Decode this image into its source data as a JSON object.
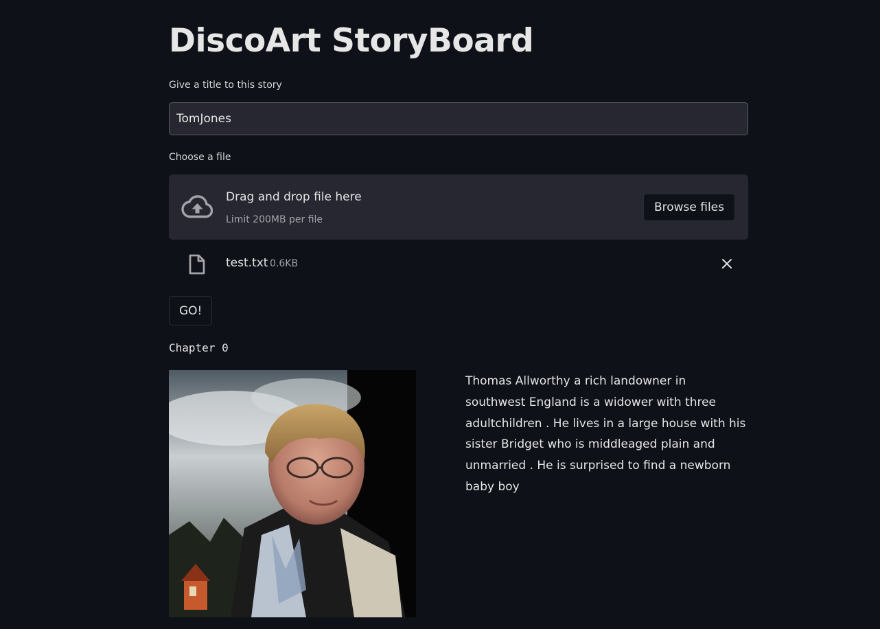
{
  "app": {
    "title": "DiscoArt StoryBoard"
  },
  "story_title": {
    "label": "Give a title to this story",
    "value": "TomJones"
  },
  "uploader": {
    "label": "Choose a file",
    "drop_text": "Drag and drop file here",
    "limit_text": "Limit 200MB per file",
    "browse_label": "Browse files",
    "icon": "cloud-upload-icon"
  },
  "uploaded_file": {
    "name": "test.txt",
    "size": "0.6KB",
    "icon": "file-icon",
    "remove_icon": "close-icon"
  },
  "go_button": {
    "label": "GO!"
  },
  "chapter": {
    "heading": "Chapter 0",
    "text": "Thomas Allworthy a rich landowner in southwest England is a widower with three adultchildren . He lives in a large house with his sister Bridget who is middleaged plain and unmarried . He is surprised to find a newborn baby boy"
  },
  "colors": {
    "background": "#0e1117",
    "panel": "#262730",
    "text": "#fafafa",
    "muted": "#a3a3a8"
  }
}
